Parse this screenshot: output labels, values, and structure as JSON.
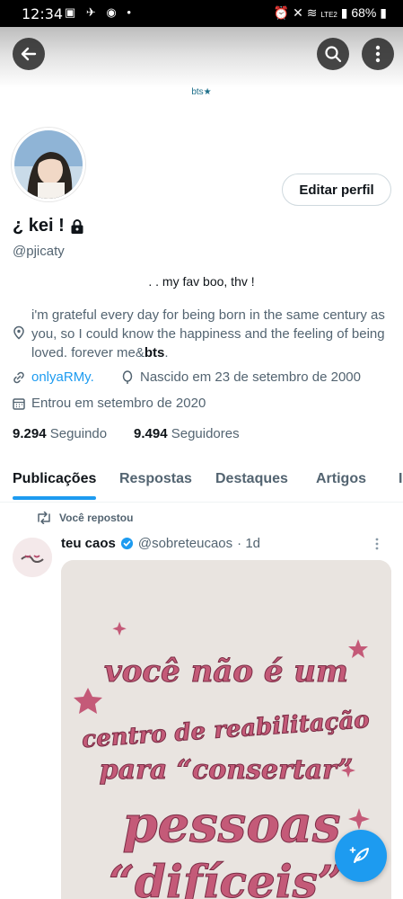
{
  "status_bar": {
    "time": "12:34",
    "battery": "68%",
    "network": "LTE2"
  },
  "header": {
    "banner_text": "bts★"
  },
  "profile": {
    "edit_label": "Editar perfil",
    "name": "¿ kei !",
    "handle": "@pjicaty",
    "bio_line1": ". . my fav boo, thv !",
    "bio_part1": "i'm grateful every day for being born in the same century as you, so I could know the happiness and the feeling of being loved.  forever me&",
    "bio_bold": "bts",
    "bio_end": ".",
    "link": "onlyaRMy.",
    "birth": "Nascido em 23 de setembro de 2000",
    "joined": "Entrou em setembro de 2020",
    "following_count": "9.294",
    "following_label": "Seguindo",
    "followers_count": "9.494",
    "followers_label": "Seguidores"
  },
  "tabs": [
    "Publicações",
    "Respostas",
    "Destaques",
    "Artigos"
  ],
  "post": {
    "repost_label": "Você repostou",
    "author_name": "teu caos",
    "author_handle": "@sobreteucaos",
    "time": "· 1d",
    "image_lines": [
      "você não é um",
      "centro de reabilitação",
      "para “consertar”",
      "pessoas",
      "“difíceis”"
    ]
  },
  "colors": {
    "accent": "#1d9bf0",
    "image_text": "#b5496a",
    "image_bg": "#e9e4e0"
  }
}
